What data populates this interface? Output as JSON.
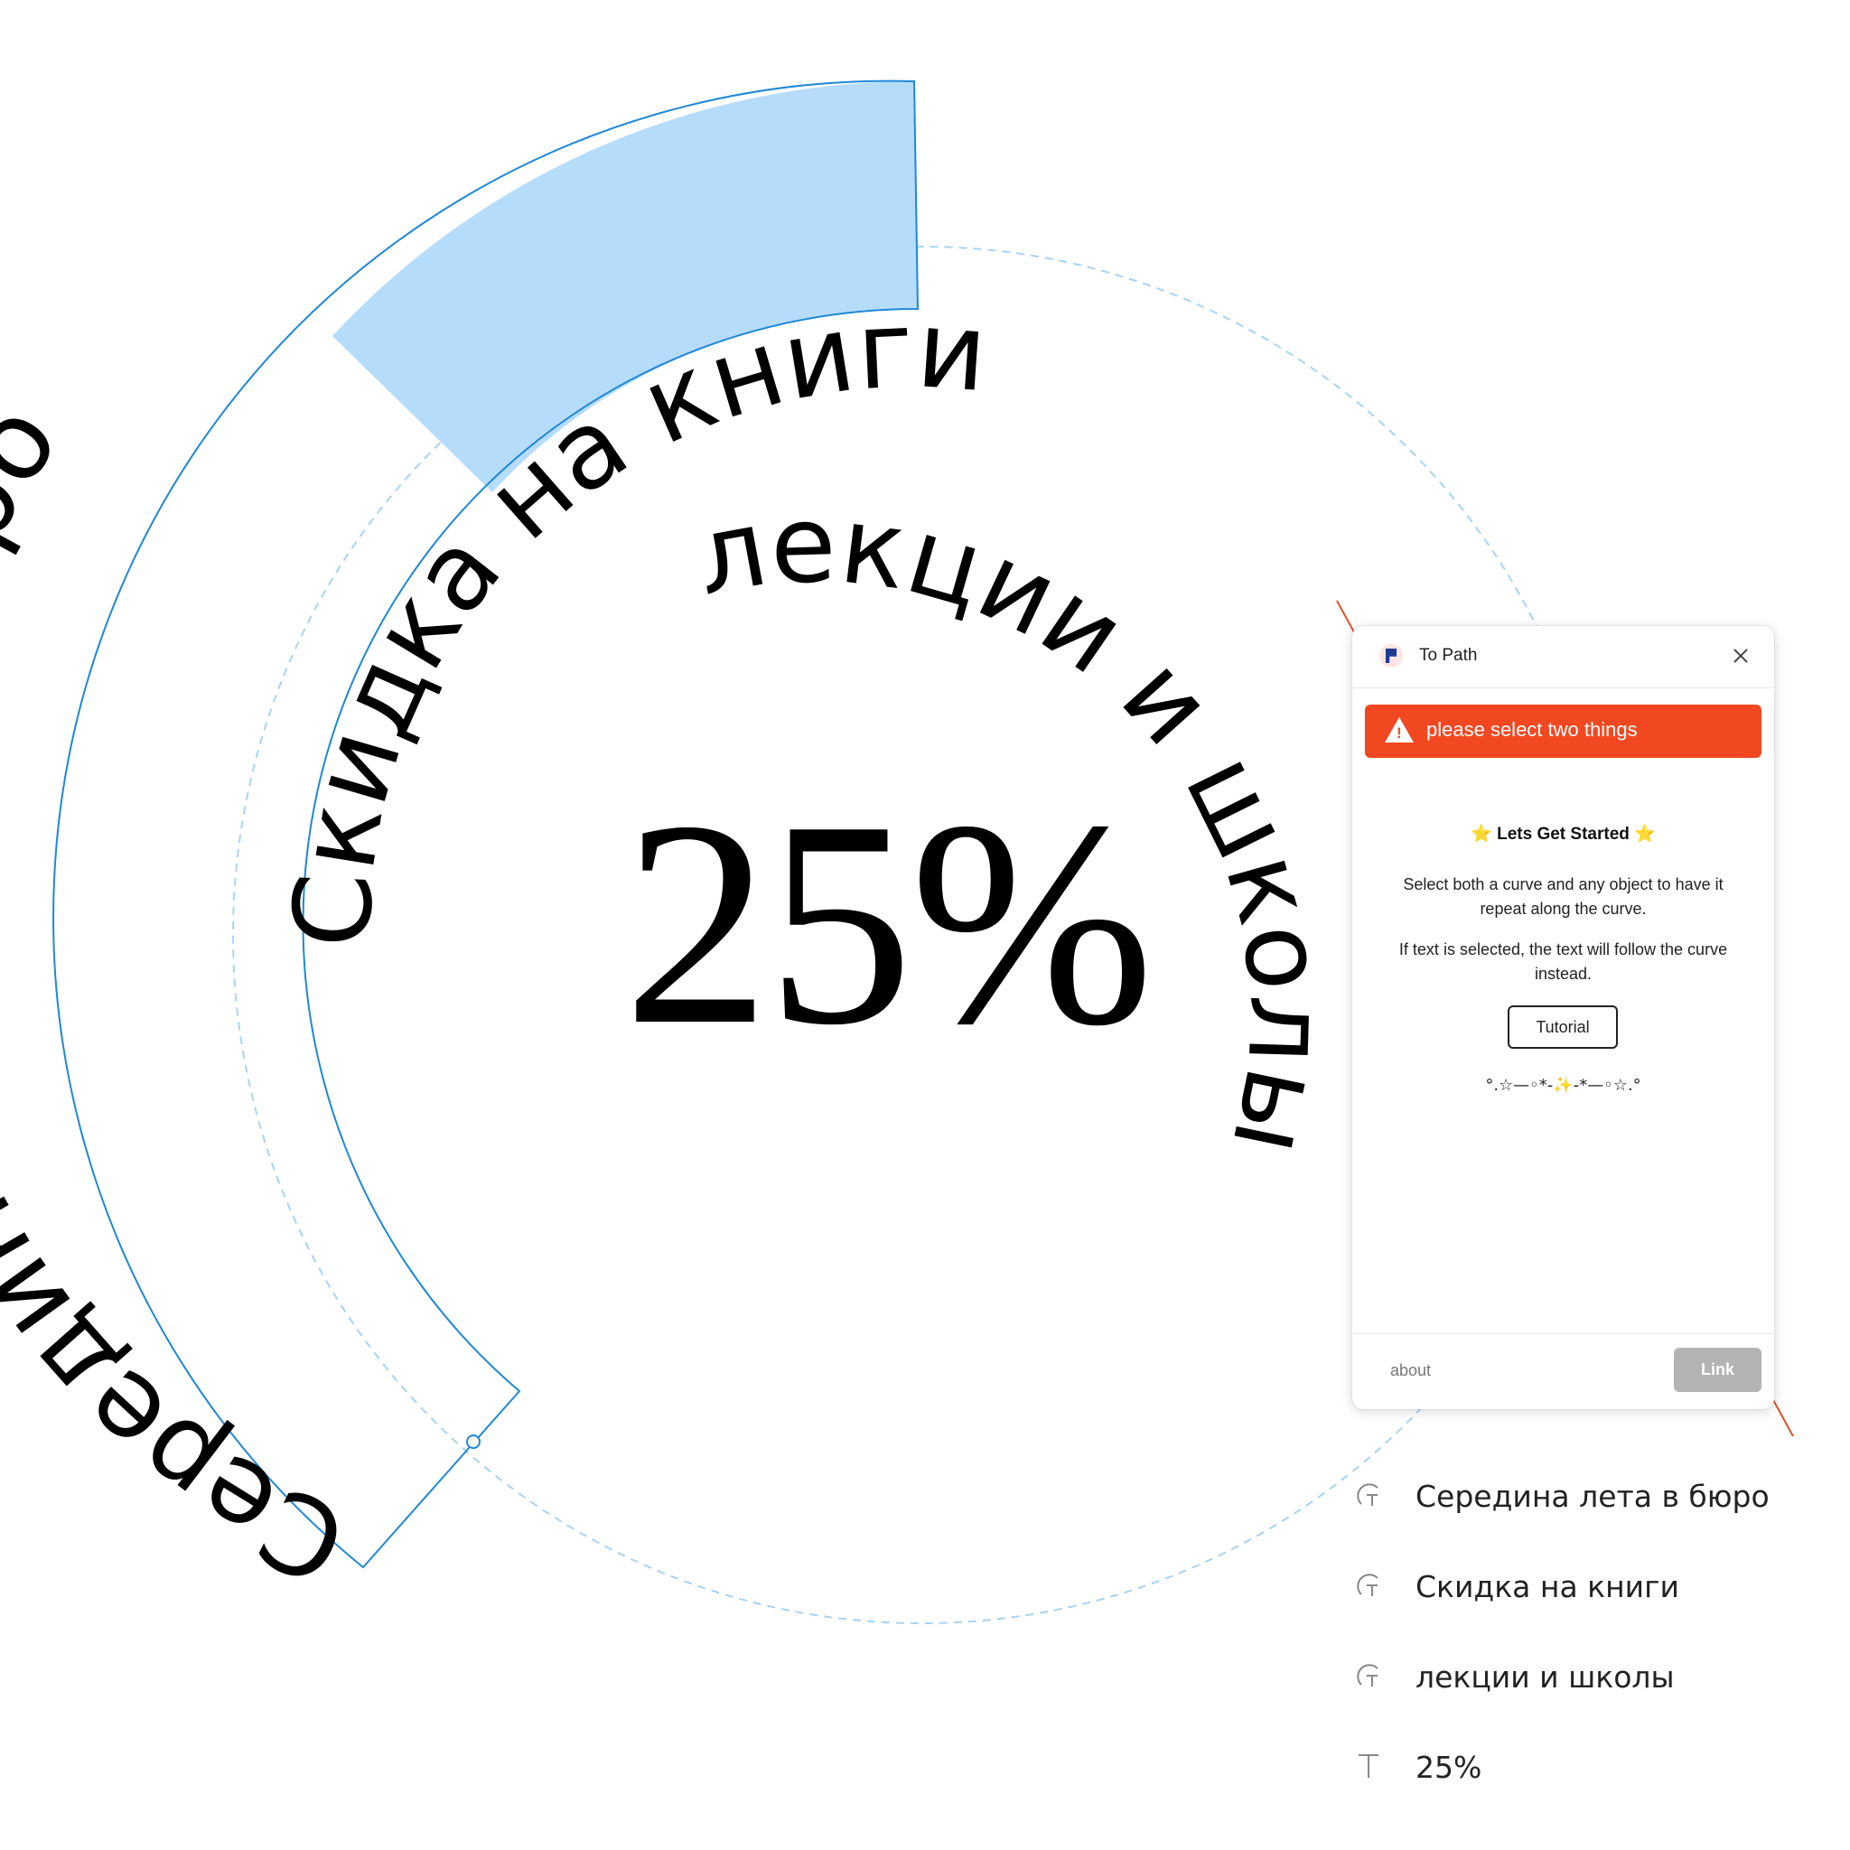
{
  "canvas": {
    "curve_texts": [
      {
        "id": "t1",
        "text": "Середина лета в бюро"
      },
      {
        "id": "t2",
        "text": "Скидка на книги"
      },
      {
        "id": "t3",
        "text": "лекции и школы"
      }
    ],
    "big_number": "25%"
  },
  "plugin": {
    "title": "To Path",
    "error": "please select two things",
    "heading": "Lets Get Started",
    "heading_stars": "⭐",
    "para1": "Select both a curve and any object to have it repeat along the curve.",
    "para2": "If text is selected, the text will follow the curve instead.",
    "tutorial_label": "Tutorial",
    "decoration": "°.☆—◦*-✨-*—◦☆.°",
    "about_label": "about",
    "link_label": "Link"
  },
  "layers": [
    {
      "icon": "text-on-path-icon",
      "label": "Середина лета в бюро"
    },
    {
      "icon": "text-on-path-icon",
      "label": "Скидка на книги"
    },
    {
      "icon": "text-on-path-icon",
      "label": "лекции и школы"
    },
    {
      "icon": "text-icon",
      "label": "25%"
    }
  ],
  "colors": {
    "selection_fill": "#b6dcfb",
    "selection_stroke": "#1e88d6",
    "error_red": "#f24822",
    "guide_line": "#e0502a"
  }
}
